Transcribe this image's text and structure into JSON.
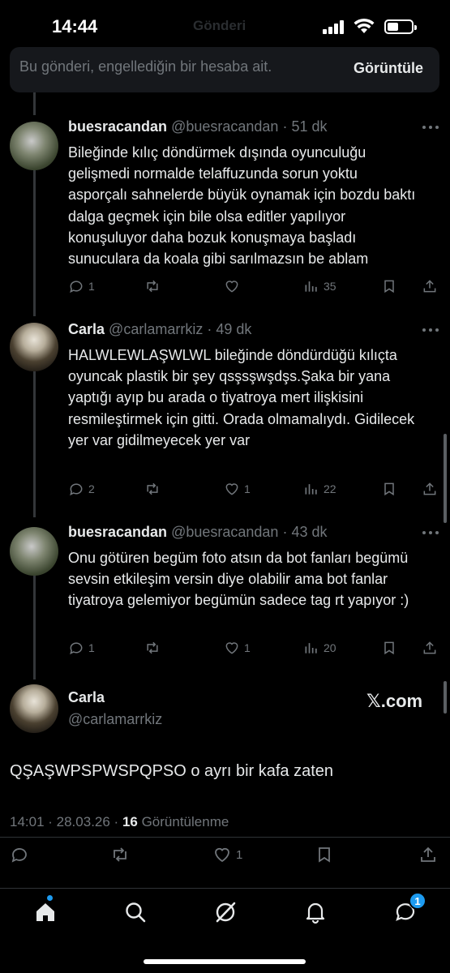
{
  "status_bar": {
    "time": "14:44",
    "faded_title": "Gönderi"
  },
  "blocked_notice": {
    "text": "Bu gönderi, engellediğin bir hesaba ait.",
    "view_label": "Görüntüle"
  },
  "replies": [
    {
      "name": "buesracandan",
      "handle": "@buesracandan",
      "time": "· 51 dk",
      "text": "Bileğinde kılıç döndürmek dışında oyunculuğu gelişmedi normalde telaffuzunda sorun yoktu asporçalı sahnelerde büyük oynamak için bozdu baktı dalga geçmek için bile olsa editler yapılıyor konuşuluyor daha bozuk konuşmaya başladı sunuculara da koala gibi sarılmazsın be ablam",
      "reply_count": "1",
      "retweet_count": "",
      "like_count": "",
      "view_count": "35"
    },
    {
      "name": "Carla",
      "handle": "@carlamarrkiz",
      "time": "· 49 dk",
      "text": "HALWLEWLAŞWLWL bileğinde döndürdüğü kılıçta oyuncak plastik bir şey qsşsşwşdşs.Şaka bir yana yaptığı ayıp bu arada o tiyatroya mert ilişkisini resmileştirmek için gitti. Orada olmamalıydı. Gidilecek yer var gidilmeyecek yer var",
      "reply_count": "2",
      "retweet_count": "",
      "like_count": "1",
      "view_count": "22"
    },
    {
      "name": "buesracandan",
      "handle": "@buesracandan",
      "time": "· 43 dk",
      "text": "Onu götüren begüm foto atsın da bot fanları begümü sevsin etkileşim versin diye olabilir ama bot fanlar tiyatroya gelemiyor begümün sadece tag rt yapıyor :)",
      "reply_count": "1",
      "retweet_count": "",
      "like_count": "1",
      "view_count": "20"
    }
  ],
  "main_tweet": {
    "name": "Carla",
    "handle": "@carlamarrkiz",
    "brand": "𝕏.com",
    "text": "QŞAŞWPSPWSPQPSO o ayrı bir kafa zaten",
    "timestamp": "14:01 · 28.03.26 · ",
    "views_count": "16",
    "views_label": " Görüntülenme",
    "like_count": "1"
  },
  "bottom_nav": {
    "messages_badge": "1"
  },
  "colors": {
    "background": "#000000",
    "text": "#e7e9ea",
    "muted": "#71767b",
    "accent": "#1d9bf0"
  }
}
